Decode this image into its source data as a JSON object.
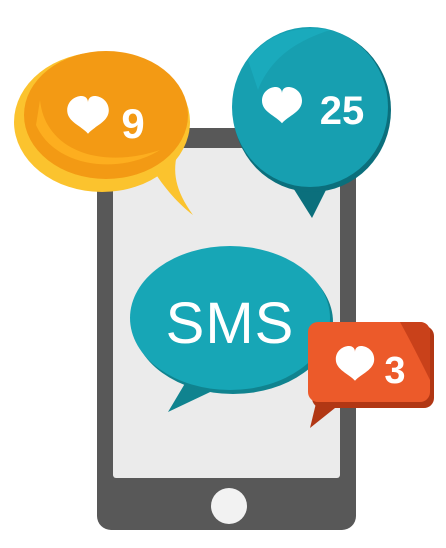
{
  "phone": {
    "colors": {
      "body": "#585858",
      "body_edge": "#4a4a4a",
      "screen": "#ebebeb",
      "home_button": "#f2f2f2"
    }
  },
  "sms_bubble": {
    "text": "SMS",
    "colors": {
      "fill": "#17a6b6",
      "shadow": "#10838f",
      "text": "#ffffff"
    }
  },
  "notifications": [
    {
      "id": "orange",
      "icon": "heart-icon",
      "count": "9",
      "colors": {
        "fill": "#f39a14",
        "accent": "#fbc32e",
        "shadow": "#d9820b",
        "icon": "#ffffff"
      }
    },
    {
      "id": "teal",
      "icon": "heart-icon",
      "count": "25",
      "colors": {
        "fill": "#179fb0",
        "accent": "#0d8796",
        "shadow": "#0b6f7c",
        "icon": "#ffffff"
      }
    },
    {
      "id": "red",
      "icon": "heart-icon",
      "count": "3",
      "colors": {
        "fill": "#ec5a2a",
        "accent": "#c9411a",
        "shadow": "#b13714",
        "icon": "#ffffff"
      }
    }
  ]
}
